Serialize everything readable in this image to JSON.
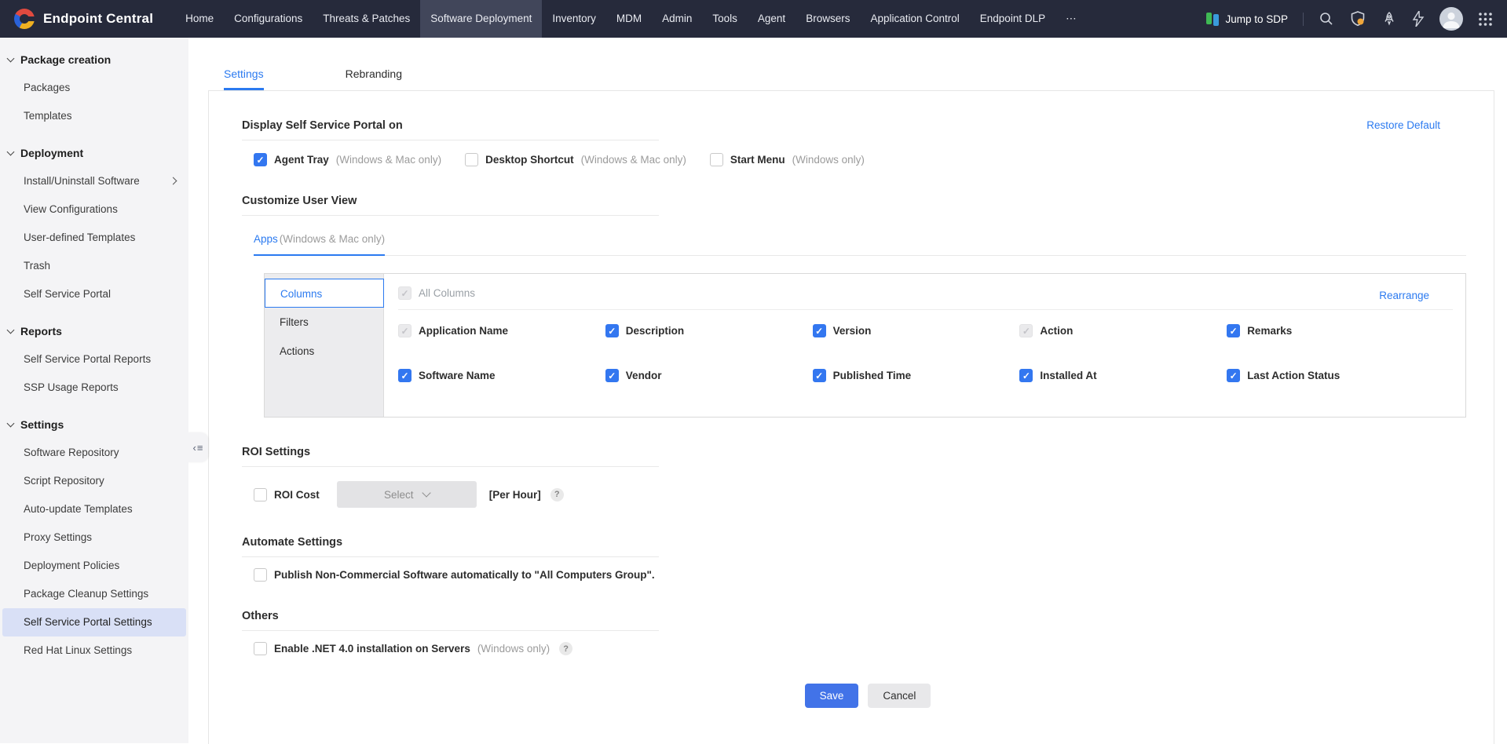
{
  "navbar": {
    "brand": "Endpoint Central",
    "items": [
      {
        "label": "Home",
        "active": false
      },
      {
        "label": "Configurations",
        "active": false
      },
      {
        "label": "Threats & Patches",
        "active": false
      },
      {
        "label": "Software Deployment",
        "active": true
      },
      {
        "label": "Inventory",
        "active": false
      },
      {
        "label": "MDM",
        "active": false
      },
      {
        "label": "Admin",
        "active": false
      },
      {
        "label": "Tools",
        "active": false
      },
      {
        "label": "Agent",
        "active": false
      },
      {
        "label": "Browsers",
        "active": false
      },
      {
        "label": "Application Control",
        "active": false
      },
      {
        "label": "Endpoint DLP",
        "active": false
      },
      {
        "label": "⋯",
        "active": false
      }
    ],
    "jump_to_sdp": "Jump to SDP",
    "right_icons": [
      "search-icon",
      "shield-alert-icon",
      "rocket-icon",
      "flash-icon",
      "user-avatar",
      "app-grid-icon"
    ]
  },
  "sidebar": {
    "sections": [
      {
        "title": "Package creation",
        "items": [
          {
            "label": "Packages"
          },
          {
            "label": "Templates"
          }
        ]
      },
      {
        "title": "Deployment",
        "items": [
          {
            "label": "Install/Uninstall Software",
            "has_submenu": true
          },
          {
            "label": "View Configurations"
          },
          {
            "label": "User-defined Templates"
          },
          {
            "label": "Trash"
          },
          {
            "label": "Self Service Portal"
          }
        ]
      },
      {
        "title": "Reports",
        "items": [
          {
            "label": "Self Service Portal Reports"
          },
          {
            "label": "SSP Usage Reports"
          }
        ]
      },
      {
        "title": "Settings",
        "items": [
          {
            "label": "Software Repository"
          },
          {
            "label": "Script Repository"
          },
          {
            "label": "Auto-update Templates"
          },
          {
            "label": "Proxy Settings"
          },
          {
            "label": "Deployment Policies"
          },
          {
            "label": "Package Cleanup Settings"
          },
          {
            "label": "Self Service Portal Settings",
            "active": true
          },
          {
            "label": "Red Hat Linux Settings"
          }
        ]
      }
    ]
  },
  "main_tabs": [
    {
      "label": "Settings",
      "active": true
    },
    {
      "label": "Rebranding",
      "active": false
    }
  ],
  "display_section": {
    "title": "Display Self Service Portal on",
    "restore_default": "Restore Default",
    "options": [
      {
        "label": "Agent Tray",
        "note": "(Windows & Mac only)",
        "checked": true
      },
      {
        "label": "Desktop Shortcut",
        "note": "(Windows & Mac only)",
        "checked": false
      },
      {
        "label": "Start Menu",
        "note": "(Windows only)",
        "checked": false
      }
    ]
  },
  "customize_section": {
    "title": "Customize User View",
    "tab_label": "Apps",
    "tab_note": "(Windows & Mac only)",
    "panel_tabs": [
      {
        "label": "Columns",
        "active": true
      },
      {
        "label": "Filters",
        "active": false
      },
      {
        "label": "Actions",
        "active": false
      }
    ],
    "all_columns": {
      "label": "All Columns",
      "checked": true,
      "disabled": true
    },
    "rearrange": "Rearrange",
    "columns": [
      {
        "label": "Application Name",
        "checked": true,
        "disabled": true
      },
      {
        "label": "Description",
        "checked": true
      },
      {
        "label": "Version",
        "checked": true
      },
      {
        "label": "Action",
        "checked": true,
        "disabled": true
      },
      {
        "label": "Remarks",
        "checked": true
      },
      {
        "label": "Software Name",
        "checked": true
      },
      {
        "label": "Vendor",
        "checked": true
      },
      {
        "label": "Published Time",
        "checked": true
      },
      {
        "label": "Installed At",
        "checked": true
      },
      {
        "label": "Last Action Status",
        "checked": true
      }
    ]
  },
  "roi_section": {
    "title": "ROI Settings",
    "checkbox_label": "ROI Cost",
    "checked": false,
    "select_placeholder": "Select",
    "per_hour": "[Per Hour]",
    "help": "?"
  },
  "automate_section": {
    "title": "Automate Settings",
    "checkbox_label": "Publish Non-Commercial Software automatically to \"All Computers Group\".",
    "checked": false
  },
  "others_section": {
    "title": "Others",
    "checkbox_label": "Enable .NET 4.0 installation on Servers",
    "note": "(Windows only)",
    "help": "?",
    "checked": false
  },
  "footer": {
    "save": "Save",
    "cancel": "Cancel"
  },
  "colors": {
    "accent": "#2b7af0",
    "navbar_bg": "#262a3b",
    "navbar_active_bg": "#41465a",
    "sidebar_bg": "#f4f4f6",
    "sidebar_active_bg": "#d9e0f6",
    "checkbox_checked": "#3377f0",
    "save_button": "#4273e8",
    "notification_badge": "#f0a63a"
  }
}
